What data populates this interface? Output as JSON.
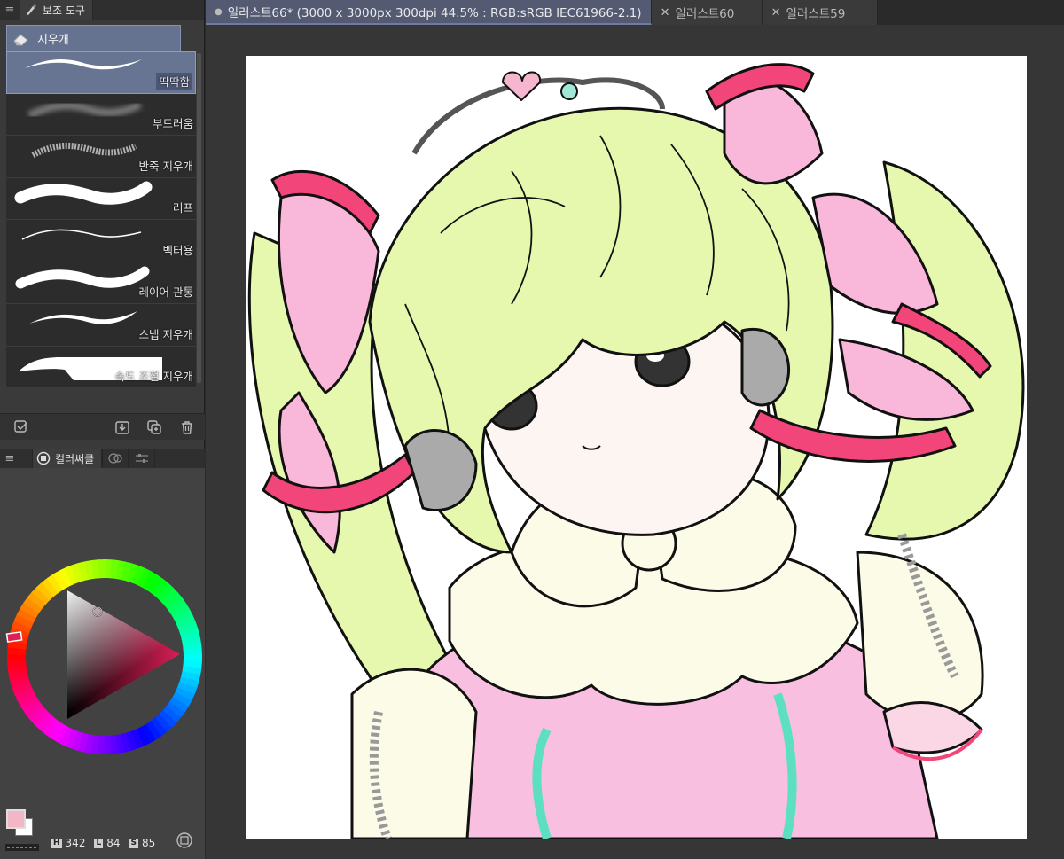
{
  "subtool_panel": {
    "tab_label": "보조 도구",
    "group_name": "지우개",
    "brushes": [
      {
        "label": "딱딱함",
        "selected": true
      },
      {
        "label": "부드러움",
        "selected": false
      },
      {
        "label": "반죽 지우개",
        "selected": false
      },
      {
        "label": "러프",
        "selected": false
      },
      {
        "label": "벡터용",
        "selected": false
      },
      {
        "label": "레이어 관통",
        "selected": false
      },
      {
        "label": "스냅 지우개",
        "selected": false
      },
      {
        "label": "속도 조절 지우개",
        "selected": false
      }
    ]
  },
  "color_panel": {
    "tab_label": "컬러써클",
    "main_color": "#f2b6c6",
    "sub_color": "#ffffff",
    "hsl": {
      "h_key": "H",
      "h": "342",
      "l_key": "L",
      "l": "84",
      "s_key": "S",
      "s": "85"
    }
  },
  "doc_tabs": [
    {
      "label": "일러스트66* (3000 x 3000px 300dpi 44.5% : RGB:sRGB IEC61966-2.1)",
      "active": true
    },
    {
      "label": "일러스트60",
      "active": false
    },
    {
      "label": "일러스트59",
      "active": false
    }
  ],
  "canvas": {
    "palette": {
      "hair": "#e6f7ae",
      "ribbon": "#f9b7d9",
      "frill": "#f2467a",
      "skin": "#fdf5f2",
      "bow": "#fbfbe8",
      "teal": "#5de0c2",
      "line": "#111111"
    }
  }
}
